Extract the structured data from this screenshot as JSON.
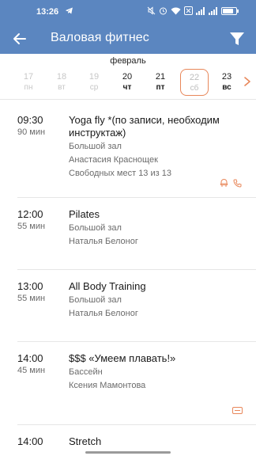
{
  "status": {
    "time": "13:26",
    "icons": [
      "telegram-icon",
      "mute-icon",
      "alarm-icon",
      "wifi-icon",
      "close-box-icon",
      "signal-icon",
      "signal-icon",
      "battery-icon"
    ],
    "battery_level": 0.7
  },
  "appbar": {
    "title": "Валовая фитнес",
    "accent": "#5b86c0"
  },
  "calendar": {
    "month": "февраль",
    "selected_color": "#e8875a",
    "days": [
      {
        "num": "17",
        "wd": "пн",
        "state": "past"
      },
      {
        "num": "18",
        "wd": "вт",
        "state": "past"
      },
      {
        "num": "19",
        "wd": "ср",
        "state": "past"
      },
      {
        "num": "20",
        "wd": "чт",
        "state": "future"
      },
      {
        "num": "21",
        "wd": "пт",
        "state": "future"
      },
      {
        "num": "22",
        "wd": "сб",
        "state": "selected"
      },
      {
        "num": "23",
        "wd": "вс",
        "state": "future"
      }
    ]
  },
  "schedule": [
    {
      "time": "09:30",
      "duration": "90 мин",
      "title": "Yoga fly *(по записи, необходим инструктаж)",
      "place": "Большой зал",
      "trainer": "Анастасия Краснощек",
      "seats": "Свободных мест 13 из 13",
      "icons": [
        "booking-icon",
        "phone-icon"
      ]
    },
    {
      "time": "12:00",
      "duration": "55 мин",
      "title": "Pilates",
      "place": "Большой зал",
      "trainer": "Наталья Белоног"
    },
    {
      "time": "13:00",
      "duration": "55 мин",
      "title": "All Body Training",
      "place": "Большой зал",
      "trainer": "Наталья Белоног"
    },
    {
      "time": "14:00",
      "duration": "45 мин",
      "title": "$$$ «Умеем плавать!»",
      "place": "Бассейн",
      "trainer": "Ксения Мамонтова",
      "icons": [
        "ticket-icon"
      ]
    },
    {
      "time": "14:00",
      "title": "Stretch"
    }
  ]
}
